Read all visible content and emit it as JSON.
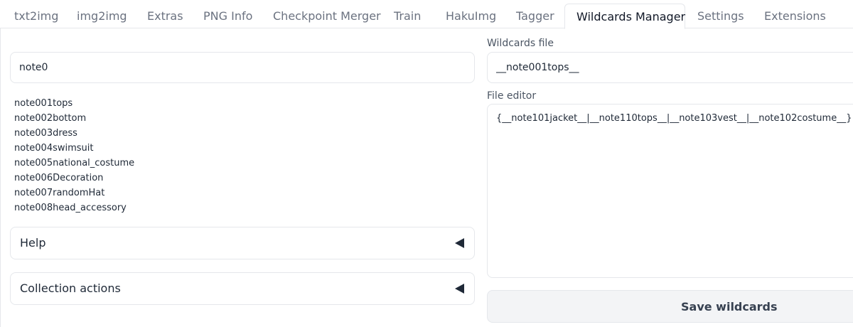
{
  "tabs": [
    {
      "label": "txt2img"
    },
    {
      "label": "img2img"
    },
    {
      "label": "Extras"
    },
    {
      "label": "PNG Info"
    },
    {
      "label": "Checkpoint Merger"
    },
    {
      "label": "Train"
    },
    {
      "label": "HakuImg"
    },
    {
      "label": "Tagger"
    },
    {
      "label": "Wildcards Manager",
      "active": true
    },
    {
      "label": "Settings"
    },
    {
      "label": "Extensions"
    }
  ],
  "search": {
    "value": "note0"
  },
  "wildcards": [
    "note001tops",
    "note002bottom",
    "note003dress",
    "note004swimsuit",
    "note005national_costume",
    "note006Decoration",
    "note007randomHat",
    "note008head_accessory"
  ],
  "accordions": {
    "help": "Help",
    "collection_actions": "Collection actions"
  },
  "file": {
    "label": "Wildcards file",
    "value": "__note001tops__"
  },
  "editor": {
    "label": "File editor",
    "value": "{__note101jacket__|__note110tops__|__note103vest__|__note102costume__}"
  },
  "save_button": "Save wildcards"
}
